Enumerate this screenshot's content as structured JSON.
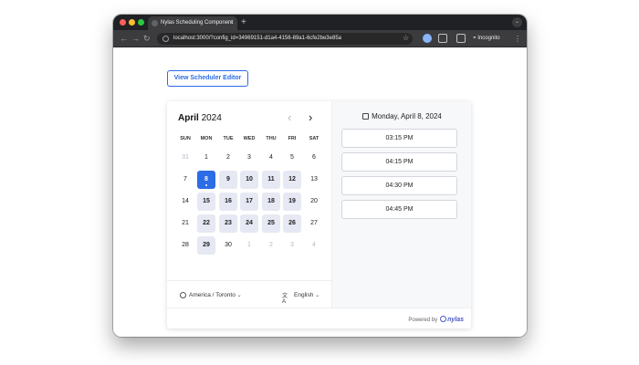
{
  "browser": {
    "tab_title": "Nylas Scheduling Component",
    "tab_close": "×",
    "new_tab": "+",
    "url": "localhost:3000/?config_id=34969151-d1a4-4156-89a1-6cfe2be3e85a",
    "incognito_label": "Incognito"
  },
  "page": {
    "editor_button": "View Scheduler Editor"
  },
  "calendar": {
    "month": "April",
    "year": "2024",
    "weekdays": [
      "SUN",
      "MON",
      "TUE",
      "WED",
      "THU",
      "FRI",
      "SAT"
    ],
    "weeks": [
      [
        {
          "d": "31",
          "s": "muted"
        },
        {
          "d": "1",
          "s": "normal"
        },
        {
          "d": "2",
          "s": "normal"
        },
        {
          "d": "3",
          "s": "normal"
        },
        {
          "d": "4",
          "s": "normal"
        },
        {
          "d": "5",
          "s": "normal"
        },
        {
          "d": "6",
          "s": "normal"
        }
      ],
      [
        {
          "d": "7",
          "s": "normal"
        },
        {
          "d": "8",
          "s": "selected"
        },
        {
          "d": "9",
          "s": "avail"
        },
        {
          "d": "10",
          "s": "avail"
        },
        {
          "d": "11",
          "s": "avail"
        },
        {
          "d": "12",
          "s": "avail"
        },
        {
          "d": "13",
          "s": "normal"
        }
      ],
      [
        {
          "d": "14",
          "s": "normal"
        },
        {
          "d": "15",
          "s": "avail"
        },
        {
          "d": "16",
          "s": "avail"
        },
        {
          "d": "17",
          "s": "avail"
        },
        {
          "d": "18",
          "s": "avail"
        },
        {
          "d": "19",
          "s": "avail"
        },
        {
          "d": "20",
          "s": "normal"
        }
      ],
      [
        {
          "d": "21",
          "s": "normal"
        },
        {
          "d": "22",
          "s": "avail"
        },
        {
          "d": "23",
          "s": "avail"
        },
        {
          "d": "24",
          "s": "avail"
        },
        {
          "d": "25",
          "s": "avail"
        },
        {
          "d": "26",
          "s": "avail"
        },
        {
          "d": "27",
          "s": "normal"
        }
      ],
      [
        {
          "d": "28",
          "s": "normal"
        },
        {
          "d": "29",
          "s": "avail"
        },
        {
          "d": "30",
          "s": "normal"
        },
        {
          "d": "1",
          "s": "muted"
        },
        {
          "d": "2",
          "s": "muted"
        },
        {
          "d": "3",
          "s": "muted"
        },
        {
          "d": "4",
          "s": "muted"
        }
      ]
    ],
    "timezone": "America / Toronto",
    "language": "English"
  },
  "timeslots": {
    "date_label": "Monday, April 8, 2024",
    "slots": [
      "03:15 PM",
      "04:15 PM",
      "04:30 PM",
      "04:45 PM"
    ]
  },
  "footer": {
    "powered_by": "Powered by",
    "brand": "nylas"
  },
  "colors": {
    "accent": "#2c6ce6",
    "available_day": "#e6e8f3",
    "brand": "#4a57c8"
  }
}
